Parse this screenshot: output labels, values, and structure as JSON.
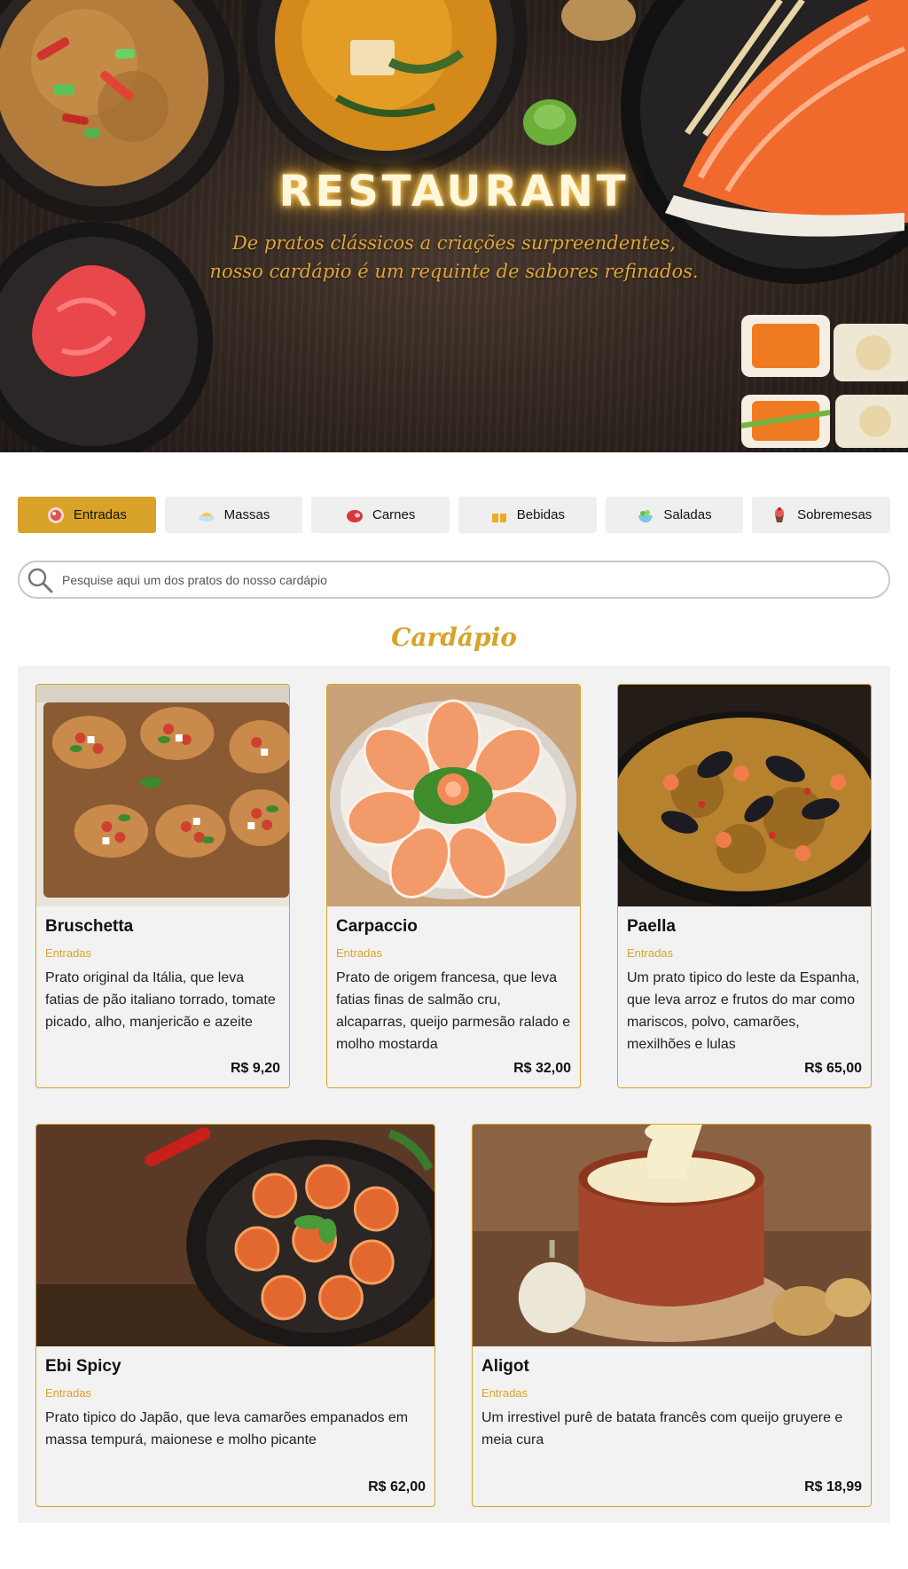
{
  "hero": {
    "title": "RESTAURANT",
    "subtitle": "De pratos clássicos a criações surpreendentes, nosso cardápio é um requinte de sabores refinados."
  },
  "tabs": [
    {
      "label": "Entradas",
      "icon": "plate-icon",
      "active": true
    },
    {
      "label": "Massas",
      "icon": "pasta-icon",
      "active": false
    },
    {
      "label": "Carnes",
      "icon": "steak-icon",
      "active": false
    },
    {
      "label": "Bebidas",
      "icon": "drinks-icon",
      "active": false
    },
    {
      "label": "Saladas",
      "icon": "salad-icon",
      "active": false
    },
    {
      "label": "Sobremesas",
      "icon": "dessert-icon",
      "active": false
    }
  ],
  "search": {
    "placeholder": "Pesquise aqui um dos pratos do nosso cardápio"
  },
  "menu": {
    "heading": "Cardápio",
    "items": [
      {
        "name": "Bruschetta",
        "category": "Entradas",
        "description": "Prato original da Itália, que leva fatias de pão italiano torrado, tomate picado, alho, manjericão e azeite",
        "price": "R$ 9,20",
        "image": "bruschetta-photo"
      },
      {
        "name": "Carpaccio",
        "category": "Entradas",
        "description": "Prato de origem francesa, que leva fatias finas de salmão cru, alcaparras, queijo parmesão ralado e molho mostarda",
        "price": "R$ 32,00",
        "image": "carpaccio-photo"
      },
      {
        "name": "Paella",
        "category": "Entradas",
        "description": "Um prato tipico do leste da Espanha, que leva arroz e frutos do mar como mariscos, polvo, camarões, mexilhões e lulas",
        "price": "R$ 65,00",
        "image": "paella-photo"
      },
      {
        "name": "Ebi Spicy",
        "category": "Entradas",
        "description": "Prato tipico do Japão, que leva camarões empanados em massa tempurá, maionese e molho picante",
        "price": "R$ 62,00",
        "image": "ebi-spicy-photo"
      },
      {
        "name": "Aligot",
        "category": "Entradas",
        "description": "Um irrestivel purê de batata francês com queijo gruyere e meia cura",
        "price": "R$ 18,99",
        "image": "aligot-photo"
      }
    ]
  },
  "colors": {
    "accent": "#d8a328",
    "tab_bg": "#efefef",
    "panel_bg": "#f2f2f2"
  }
}
